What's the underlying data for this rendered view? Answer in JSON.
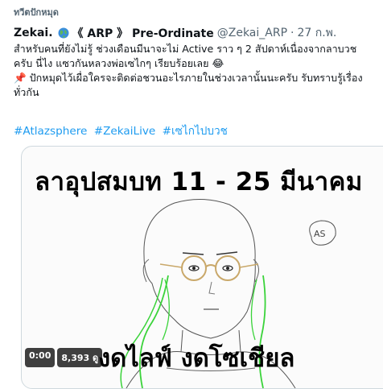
{
  "pinned_label": "ทวีตปักหมุด",
  "tweet": {
    "display_name": "Zekai.",
    "display_name_suffix": "《 ARP 》 Pre-Ordinate",
    "handle": "@Zekai_ARP",
    "separator": "·",
    "date": "27 ก.พ.",
    "body_lines": [
      "สำหรับคนที่ยังไม่รู้ ช่วงเดือนมีนาจะไม่ Active ราว ๆ 2 สัปดาห์เนื่องจากลาบวช",
      "ครับ นี่ไง แซวกันหลวงพ่อเซไกๆ เรียบร้อยเลย 😂",
      "📌 ปักหมุดไว้เผื่อใครจะติดต่อชวนอะไรภายในช่วงเวลานั้นนะครับ รับทราบรู้เรื่อง",
      "ทั่วกัน"
    ],
    "hashtags": [
      "#Atlazsphere",
      "#ZekaiLive",
      "#เซไกไปบวช"
    ]
  },
  "media": {
    "caption_top": "ลาอุปสมบท 11 - 25 มีนาคม",
    "caption_bottom": "งดไลฟ์ งดโซเชียล",
    "signature": "AS",
    "video_time": "0:00",
    "view_count": "8,393 ดู"
  },
  "colors": {
    "accent": "#1d9bf0",
    "text": "#0f1419",
    "muted": "#536471",
    "hair_lines": "#3ad33a",
    "glasses": "#c9a86a"
  },
  "icons": {
    "pin": "pin-icon",
    "globe": "globe-emoji-icon"
  }
}
